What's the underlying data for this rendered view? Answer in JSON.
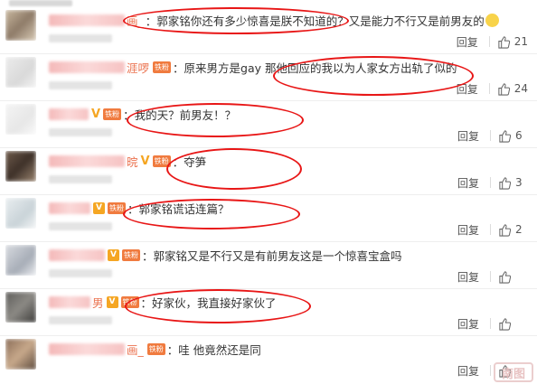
{
  "comments": [
    {
      "nick": "画_",
      "fan": "",
      "badge": "",
      "text": "：郭家铭你还有多少惊喜是朕不知道的？又是能力不行又是前男友的",
      "reply": "回复",
      "likes": "21",
      "emoji": true
    },
    {
      "nick": "涯啰",
      "fan": "铁粉",
      "badge": "",
      "text": "：原来男方是gay  那他回应的我以为人家女方出轨了似的",
      "reply": "回复",
      "likes": "24",
      "emoji": false
    },
    {
      "nick": "",
      "fan": "铁粉",
      "badge": "V",
      "text": "：我的天？前男友！？",
      "reply": "回复",
      "likes": "6",
      "emoji": false
    },
    {
      "nick": "晥",
      "fan": "铁粉",
      "badge": "V",
      "text": "：夺笋",
      "reply": "回复",
      "likes": "3",
      "emoji": false
    },
    {
      "nick": "",
      "fan": "铁粉",
      "badge": "V",
      "text": "：郭家铭谎话连篇？",
      "reply": "回复",
      "likes": "2",
      "emoji": false
    },
    {
      "nick": "",
      "fan": "铁粉",
      "badge": "V",
      "text": "：郭家铭又是不行又是有前男友这是一个惊喜宝盒吗",
      "reply": "回复",
      "likes": "",
      "emoji": false
    },
    {
      "nick": "男",
      "fan": "铁粉",
      "badge": "V",
      "text": "：好家伙，我直接好家伙了",
      "reply": "回复",
      "likes": "",
      "emoji": false
    },
    {
      "nick": "画_",
      "fan": "铁粉",
      "badge": "",
      "text": "：哇 他竟然还是同",
      "reply": "回复",
      "likes": "",
      "emoji": false
    }
  ],
  "watermark": "南图"
}
